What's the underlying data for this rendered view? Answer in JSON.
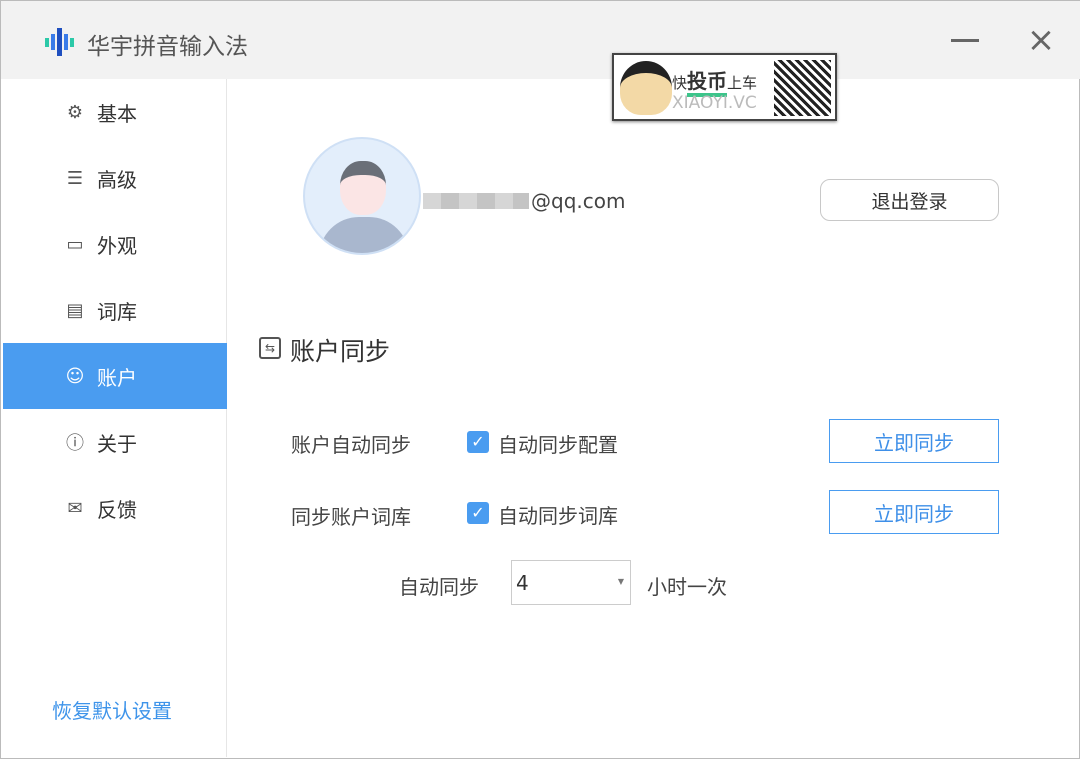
{
  "app": {
    "title": "华宇拼音输入法",
    "logo_icon": "sound-bars-logo"
  },
  "sidebar": {
    "items": [
      {
        "label": "基本",
        "icon": "gear-icon"
      },
      {
        "label": "高级",
        "icon": "sliders-icon"
      },
      {
        "label": "外观",
        "icon": "display-icon"
      },
      {
        "label": "词库",
        "icon": "notepad-icon"
      },
      {
        "label": "账户",
        "icon": "user-icon",
        "active": true
      },
      {
        "label": "关于",
        "icon": "info-icon"
      },
      {
        "label": "反馈",
        "icon": "mail-icon"
      }
    ],
    "restore_label": "恢复默认设置"
  },
  "watermark": {
    "line1_a": "快",
    "line1_b": "投币",
    "line1_c": "上车",
    "line2": "XIAOYI.VC"
  },
  "account": {
    "email_suffix": "@qq.com",
    "logout_label": "退出登录"
  },
  "sync": {
    "title": "账户同步",
    "rows": [
      {
        "label": "账户自动同步",
        "checkbox_label": "自动同步配置",
        "checked": true,
        "button": "立即同步"
      },
      {
        "label": "同步账户词库",
        "checkbox_label": "自动同步词库",
        "checked": true,
        "button": "立即同步"
      }
    ],
    "interval_label": "自动同步",
    "interval_value": "4",
    "interval_unit": "小时一次"
  },
  "colors": {
    "accent": "#4a9cf0",
    "link": "#3e94ea"
  }
}
